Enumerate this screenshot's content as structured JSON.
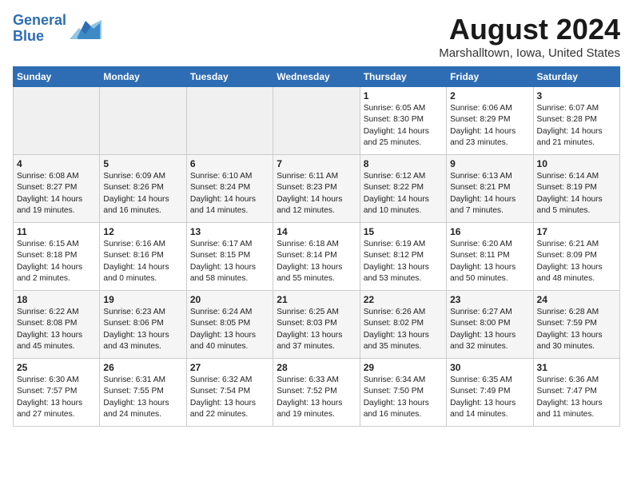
{
  "header": {
    "logo_line1": "General",
    "logo_line2": "Blue",
    "month": "August 2024",
    "location": "Marshalltown, Iowa, United States"
  },
  "weekdays": [
    "Sunday",
    "Monday",
    "Tuesday",
    "Wednesday",
    "Thursday",
    "Friday",
    "Saturday"
  ],
  "weeks": [
    [
      {
        "num": "",
        "empty": true
      },
      {
        "num": "",
        "empty": true
      },
      {
        "num": "",
        "empty": true
      },
      {
        "num": "",
        "empty": true
      },
      {
        "num": "1",
        "rise": "6:05 AM",
        "set": "8:30 PM",
        "daylight": "14 hours and 25 minutes."
      },
      {
        "num": "2",
        "rise": "6:06 AM",
        "set": "8:29 PM",
        "daylight": "14 hours and 23 minutes."
      },
      {
        "num": "3",
        "rise": "6:07 AM",
        "set": "8:28 PM",
        "daylight": "14 hours and 21 minutes."
      }
    ],
    [
      {
        "num": "4",
        "rise": "6:08 AM",
        "set": "8:27 PM",
        "daylight": "14 hours and 19 minutes."
      },
      {
        "num": "5",
        "rise": "6:09 AM",
        "set": "8:26 PM",
        "daylight": "14 hours and 16 minutes."
      },
      {
        "num": "6",
        "rise": "6:10 AM",
        "set": "8:24 PM",
        "daylight": "14 hours and 14 minutes."
      },
      {
        "num": "7",
        "rise": "6:11 AM",
        "set": "8:23 PM",
        "daylight": "14 hours and 12 minutes."
      },
      {
        "num": "8",
        "rise": "6:12 AM",
        "set": "8:22 PM",
        "daylight": "14 hours and 10 minutes."
      },
      {
        "num": "9",
        "rise": "6:13 AM",
        "set": "8:21 PM",
        "daylight": "14 hours and 7 minutes."
      },
      {
        "num": "10",
        "rise": "6:14 AM",
        "set": "8:19 PM",
        "daylight": "14 hours and 5 minutes."
      }
    ],
    [
      {
        "num": "11",
        "rise": "6:15 AM",
        "set": "8:18 PM",
        "daylight": "14 hours and 2 minutes."
      },
      {
        "num": "12",
        "rise": "6:16 AM",
        "set": "8:16 PM",
        "daylight": "14 hours and 0 minutes."
      },
      {
        "num": "13",
        "rise": "6:17 AM",
        "set": "8:15 PM",
        "daylight": "13 hours and 58 minutes."
      },
      {
        "num": "14",
        "rise": "6:18 AM",
        "set": "8:14 PM",
        "daylight": "13 hours and 55 minutes."
      },
      {
        "num": "15",
        "rise": "6:19 AM",
        "set": "8:12 PM",
        "daylight": "13 hours and 53 minutes."
      },
      {
        "num": "16",
        "rise": "6:20 AM",
        "set": "8:11 PM",
        "daylight": "13 hours and 50 minutes."
      },
      {
        "num": "17",
        "rise": "6:21 AM",
        "set": "8:09 PM",
        "daylight": "13 hours and 48 minutes."
      }
    ],
    [
      {
        "num": "18",
        "rise": "6:22 AM",
        "set": "8:08 PM",
        "daylight": "13 hours and 45 minutes."
      },
      {
        "num": "19",
        "rise": "6:23 AM",
        "set": "8:06 PM",
        "daylight": "13 hours and 43 minutes."
      },
      {
        "num": "20",
        "rise": "6:24 AM",
        "set": "8:05 PM",
        "daylight": "13 hours and 40 minutes."
      },
      {
        "num": "21",
        "rise": "6:25 AM",
        "set": "8:03 PM",
        "daylight": "13 hours and 37 minutes."
      },
      {
        "num": "22",
        "rise": "6:26 AM",
        "set": "8:02 PM",
        "daylight": "13 hours and 35 minutes."
      },
      {
        "num": "23",
        "rise": "6:27 AM",
        "set": "8:00 PM",
        "daylight": "13 hours and 32 minutes."
      },
      {
        "num": "24",
        "rise": "6:28 AM",
        "set": "7:59 PM",
        "daylight": "13 hours and 30 minutes."
      }
    ],
    [
      {
        "num": "25",
        "rise": "6:30 AM",
        "set": "7:57 PM",
        "daylight": "13 hours and 27 minutes."
      },
      {
        "num": "26",
        "rise": "6:31 AM",
        "set": "7:55 PM",
        "daylight": "13 hours and 24 minutes."
      },
      {
        "num": "27",
        "rise": "6:32 AM",
        "set": "7:54 PM",
        "daylight": "13 hours and 22 minutes."
      },
      {
        "num": "28",
        "rise": "6:33 AM",
        "set": "7:52 PM",
        "daylight": "13 hours and 19 minutes."
      },
      {
        "num": "29",
        "rise": "6:34 AM",
        "set": "7:50 PM",
        "daylight": "13 hours and 16 minutes."
      },
      {
        "num": "30",
        "rise": "6:35 AM",
        "set": "7:49 PM",
        "daylight": "13 hours and 14 minutes."
      },
      {
        "num": "31",
        "rise": "6:36 AM",
        "set": "7:47 PM",
        "daylight": "13 hours and 11 minutes."
      }
    ]
  ]
}
